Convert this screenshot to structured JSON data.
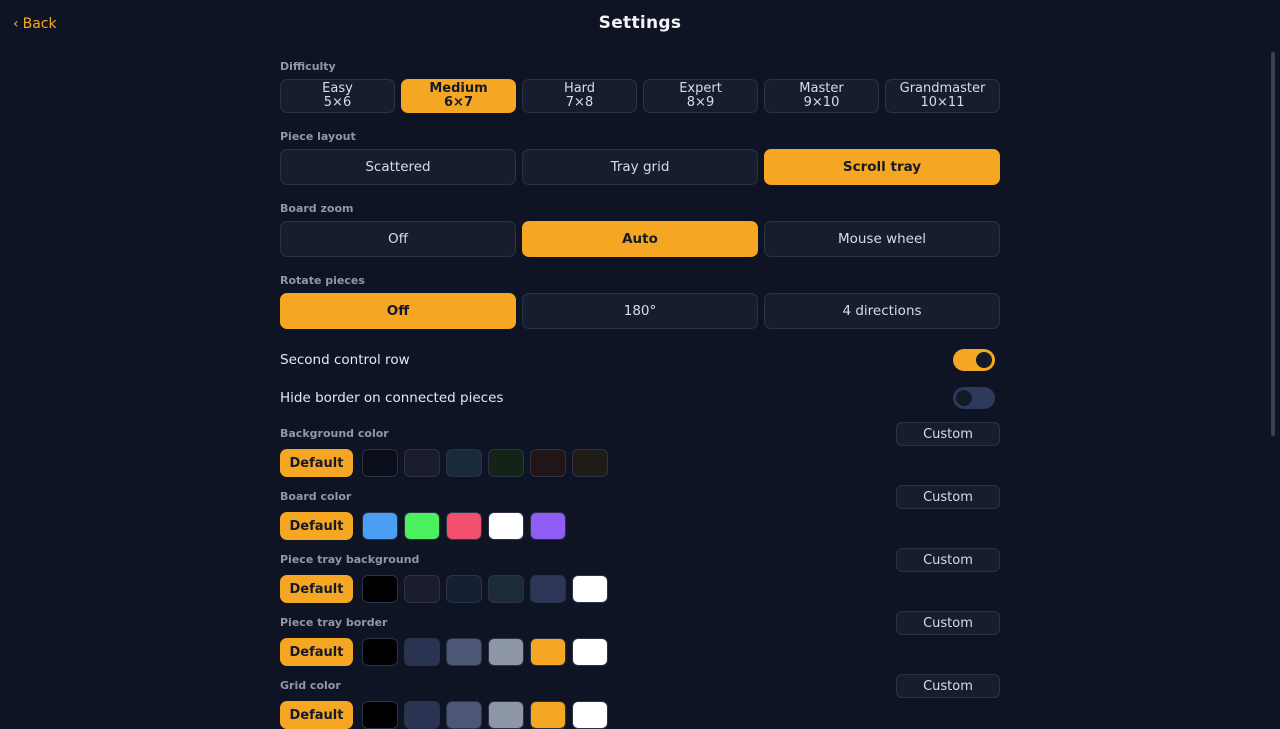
{
  "header": {
    "back_label": "Back",
    "back_icon": "chevron-left-icon",
    "title": "Settings"
  },
  "difficulty": {
    "label": "Difficulty",
    "options": [
      {
        "name": "Easy",
        "size": "5×6",
        "active": false
      },
      {
        "name": "Medium",
        "size": "6×7",
        "active": true
      },
      {
        "name": "Hard",
        "size": "7×8",
        "active": false
      },
      {
        "name": "Expert",
        "size": "8×9",
        "active": false
      },
      {
        "name": "Master",
        "size": "9×10",
        "active": false
      },
      {
        "name": "Grandmaster",
        "size": "10×11",
        "active": false
      }
    ]
  },
  "piece_layout": {
    "label": "Piece layout",
    "options": [
      {
        "label": "Scattered",
        "active": false
      },
      {
        "label": "Tray grid",
        "active": false
      },
      {
        "label": "Scroll tray",
        "active": true
      }
    ]
  },
  "board_zoom": {
    "label": "Board zoom",
    "options": [
      {
        "label": "Off",
        "active": false
      },
      {
        "label": "Auto",
        "active": true
      },
      {
        "label": "Mouse wheel",
        "active": false
      }
    ]
  },
  "rotate_pieces": {
    "label": "Rotate pieces",
    "options": [
      {
        "label": "Off",
        "active": true
      },
      {
        "label": "180°",
        "active": false
      },
      {
        "label": "4 directions",
        "active": false
      }
    ]
  },
  "toggles": {
    "second_control_row": {
      "label": "Second control row",
      "on": true
    },
    "hide_border": {
      "label": "Hide border on connected pieces",
      "on": false
    }
  },
  "colors": {
    "accent": "#f5a623",
    "background": "#0f1424",
    "surface": "#161d2f"
  },
  "color_sections": [
    {
      "id": "background-color",
      "label": "Background color",
      "default_label": "Default",
      "custom_label": "Custom",
      "swatches": [
        "#0b0f1c",
        "#1b1c30",
        "#1a2a3c",
        "#142318",
        "#221518",
        "#1f1b16"
      ]
    },
    {
      "id": "board-color",
      "label": "Board color",
      "default_label": "Default",
      "custom_label": "Custom",
      "swatches": [
        "#4a9ff5",
        "#4cf05f",
        "#f2506e",
        "#ffffff",
        "#8f5cf5"
      ]
    },
    {
      "id": "piece-tray-background",
      "label": "Piece tray background",
      "default_label": "Default",
      "custom_label": "Custom",
      "swatches": [
        "#000000",
        "#1b1c30",
        "#162033",
        "#1c2b38",
        "#2d3657",
        "#ffffff"
      ]
    },
    {
      "id": "piece-tray-border",
      "label": "Piece tray border",
      "default_label": "Default",
      "custom_label": "Custom",
      "swatches": [
        "#000000",
        "#2a3352",
        "#4d5675",
        "#8e97a8",
        "#f5a623",
        "#ffffff"
      ]
    },
    {
      "id": "grid-color",
      "label": "Grid color",
      "default_label": "Default",
      "custom_label": "Custom",
      "swatches": [
        "#000000",
        "#2a3352",
        "#4d5675",
        "#8e97a8",
        "#f5a623",
        "#ffffff"
      ]
    }
  ]
}
